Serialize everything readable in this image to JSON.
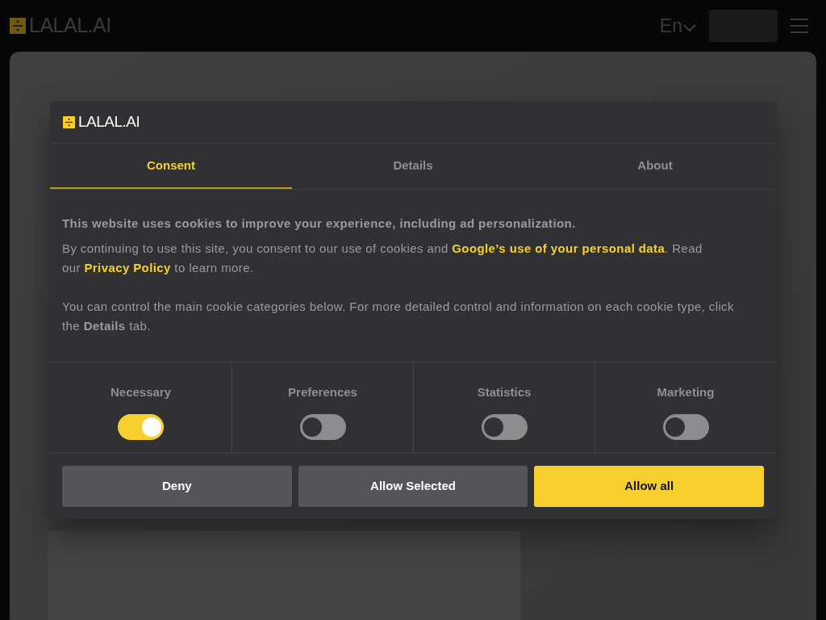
{
  "header": {
    "logo": "LALAL.AI",
    "language": "En"
  },
  "dialog": {
    "logo": "LALAL.AI",
    "tabs": [
      {
        "label": "Consent",
        "selected": true
      },
      {
        "label": "Details",
        "selected": false
      },
      {
        "label": "About",
        "selected": false
      }
    ],
    "intro": "This website uses cookies to improve your experience, including ad personalization.",
    "paragraph": [
      {
        "kind": "text",
        "text": "By continuing to use this site, you consent to our use of cookies and "
      },
      {
        "kind": "link",
        "text": "Google’s use of your personal data"
      },
      {
        "kind": "text",
        "text": ". Read our "
      },
      {
        "kind": "link",
        "text": "Privacy Policy"
      },
      {
        "kind": "text",
        "text": " to learn more."
      }
    ],
    "note": "You can control the main cookie categories below. For more detailed control and information on each cookie type, click the **Details** tab.",
    "categories": [
      {
        "label": "Necessary",
        "on": true
      },
      {
        "label": "Preferences",
        "on": false
      },
      {
        "label": "Statistics",
        "on": false
      },
      {
        "label": "Marketing",
        "on": false
      }
    ],
    "buttons": [
      {
        "label": "Deny",
        "kind": "secondary"
      },
      {
        "label": "Allow Selected",
        "kind": "secondary"
      },
      {
        "label": "Allow all",
        "kind": "primary"
      }
    ]
  }
}
